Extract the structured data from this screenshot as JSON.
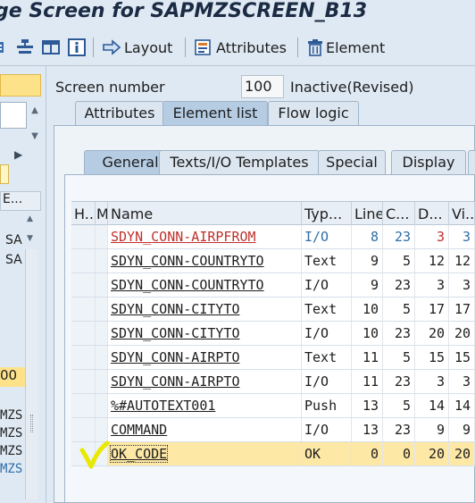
{
  "title": "ge Screen for SAPMZSCREEN_B13",
  "toolbar": {
    "layout": "Layout",
    "attributes": "Attributes",
    "element": "Element"
  },
  "left": {
    "header_label": "E...",
    "rows_sa": [
      "SA",
      "SA"
    ],
    "value_00": "00",
    "mzs_items": [
      "MZS",
      "MZS",
      "MZS",
      "MZS"
    ]
  },
  "screen": {
    "number_label": "Screen number",
    "number_value": "100",
    "status": "Inactive(Revised)"
  },
  "tabs_main": [
    "Attributes",
    "Element list",
    "Flow logic"
  ],
  "tabs_sub": [
    "General",
    "Texts/I/O Templates",
    "Special",
    "Display"
  ],
  "table": {
    "headers": [
      "H...",
      "M",
      "Name",
      "Typ...",
      "Line",
      "C...",
      "D...",
      "Vi..."
    ],
    "rows": [
      {
        "name": "SDYN_CONN-AIRPFROM",
        "type": "I/O",
        "line": "8",
        "col": "23",
        "def": "3",
        "vis": "3"
      },
      {
        "name": "SDYN_CONN-COUNTRYTO",
        "type": "Text",
        "line": "9",
        "col": "5",
        "def": "12",
        "vis": "12"
      },
      {
        "name": "SDYN_CONN-COUNTRYTO",
        "type": "I/O",
        "line": "9",
        "col": "23",
        "def": "3",
        "vis": "3"
      },
      {
        "name": "SDYN_CONN-CITYTO",
        "type": "Text",
        "line": "10",
        "col": "5",
        "def": "17",
        "vis": "17"
      },
      {
        "name": "SDYN_CONN-CITYTO",
        "type": "I/O",
        "line": "10",
        "col": "23",
        "def": "20",
        "vis": "20"
      },
      {
        "name": "SDYN_CONN-AIRPTO",
        "type": "Text",
        "line": "11",
        "col": "5",
        "def": "15",
        "vis": "15"
      },
      {
        "name": "SDYN_CONN-AIRPTO",
        "type": "I/O",
        "line": "11",
        "col": "23",
        "def": "3",
        "vis": "3"
      },
      {
        "name": "%#AUTOTEXT001",
        "type": "Push",
        "line": "13",
        "col": "5",
        "def": "14",
        "vis": "14"
      },
      {
        "name": "COMMAND",
        "type": "I/O",
        "line": "13",
        "col": "23",
        "def": "9",
        "vis": "9"
      },
      {
        "name": "OK_CODE",
        "type": "OK",
        "line": "0",
        "col": "0",
        "def": "20",
        "vis": "20"
      }
    ]
  },
  "colors": {
    "accent_yellow": "#fde28a",
    "error_red": "#c0302b",
    "blue_value": "#2f6ea8",
    "check_mark": "#e8e800"
  }
}
